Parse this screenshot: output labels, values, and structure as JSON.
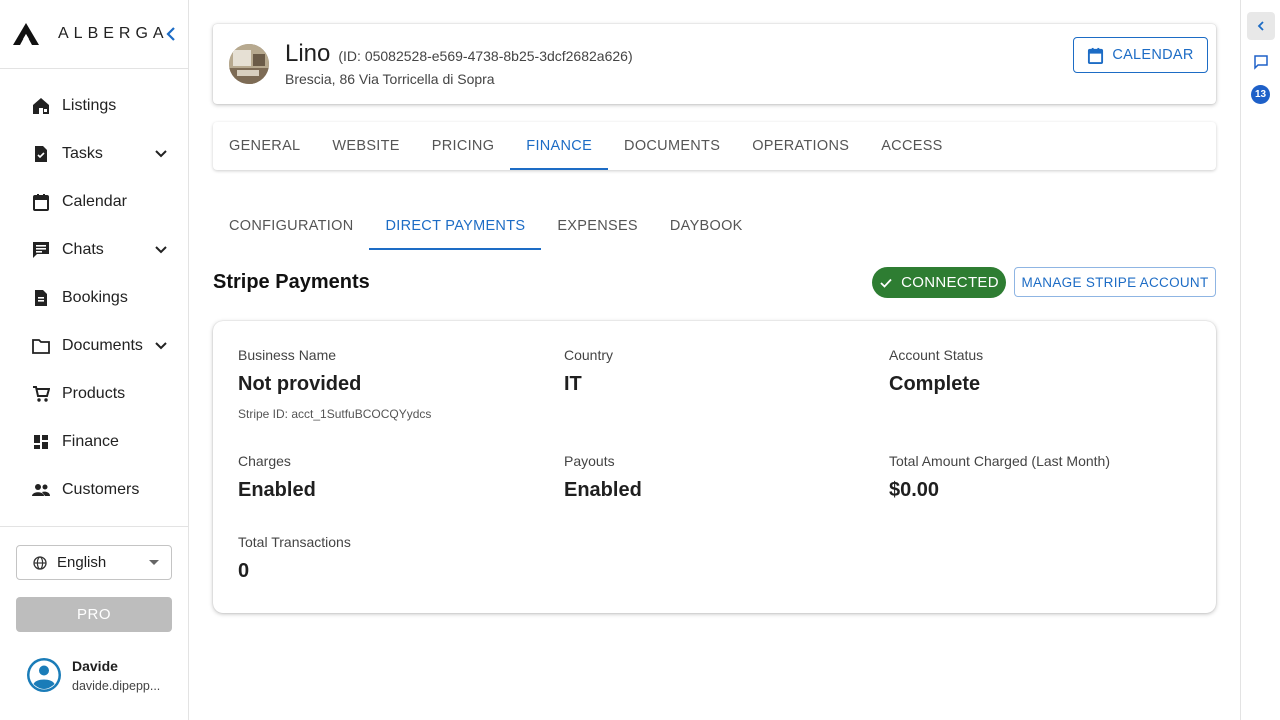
{
  "brand": {
    "name": "ALBERGA"
  },
  "sidebar": {
    "items": [
      {
        "label": "Listings",
        "icon": "home-icon"
      },
      {
        "label": "Tasks",
        "icon": "task-icon",
        "expandable": true
      },
      {
        "label": "Calendar",
        "icon": "calendar-icon"
      },
      {
        "label": "Chats",
        "icon": "chat-icon",
        "expandable": true
      },
      {
        "label": "Bookings",
        "icon": "bookings-icon"
      },
      {
        "label": "Documents",
        "icon": "folder-icon",
        "expandable": true
      },
      {
        "label": "Products",
        "icon": "cart-icon"
      },
      {
        "label": "Finance",
        "icon": "dashboard-icon"
      },
      {
        "label": "Customers",
        "icon": "people-icon"
      }
    ],
    "language": "English",
    "pro_label": "PRO",
    "user": {
      "name": "Davide",
      "email": "davide.dipepp..."
    }
  },
  "rail": {
    "badge": "13"
  },
  "property": {
    "name": "Lino",
    "id_text": "(ID: 05082528-e569-4738-8b25-3dcf2682a626)",
    "address": "Brescia, 86 Via Torricella di Sopra",
    "calendar_label": "CALENDAR"
  },
  "tabs": [
    "GENERAL",
    "WEBSITE",
    "PRICING",
    "FINANCE",
    "DOCUMENTS",
    "OPERATIONS",
    "ACCESS"
  ],
  "active_tab": "FINANCE",
  "subtabs": [
    "CONFIGURATION",
    "DIRECT PAYMENTS",
    "EXPENSES",
    "DAYBOOK"
  ],
  "active_subtab": "DIRECT PAYMENTS",
  "stripe": {
    "title": "Stripe Payments",
    "status_label": "CONNECTED",
    "status_color": "#2e7d32",
    "manage_label": "MANAGE STRIPE ACCOUNT",
    "business_name": {
      "label": "Business Name",
      "value": "Not provided",
      "sub": "Stripe ID: acct_1SutfuBCOCQYydcs"
    },
    "country": {
      "label": "Country",
      "value": "IT"
    },
    "account_status": {
      "label": "Account Status",
      "value": "Complete"
    },
    "charges": {
      "label": "Charges",
      "value": "Enabled"
    },
    "payouts": {
      "label": "Payouts",
      "value": "Enabled"
    },
    "total_charged": {
      "label": "Total Amount Charged (Last Month)",
      "value": "$0.00"
    },
    "total_transactions": {
      "label": "Total Transactions",
      "value": "0"
    }
  },
  "colors": {
    "accent": "#1d6cc5",
    "badge": "#1e60c8"
  }
}
